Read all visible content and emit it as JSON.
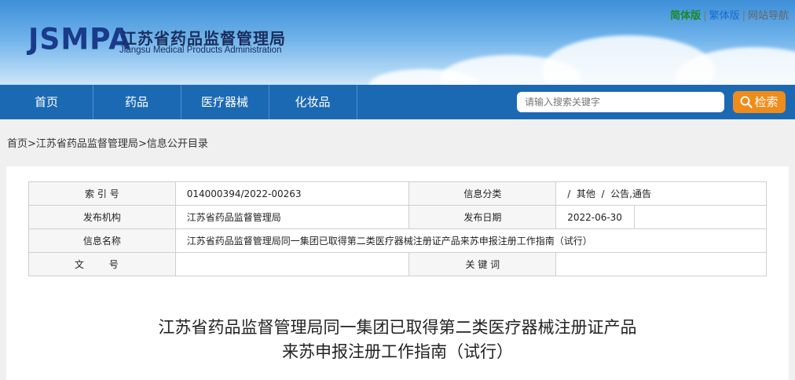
{
  "header": {
    "logo_mark": "JSMPA",
    "logo_cn": "江苏省药品监督管理局",
    "logo_en": "Jiangsu Medical Products Administration",
    "links": {
      "simplified": "简体版",
      "traditional": "繁体版",
      "sitemap": "网站导航",
      "sep": "|"
    }
  },
  "nav": {
    "items": [
      "首页",
      "药品",
      "医疗器械",
      "化妆品"
    ],
    "search_placeholder": "请输入搜索关键字",
    "search_button": "检索"
  },
  "breadcrumb": {
    "home": "首页",
    "level1": "江苏省药品监督管理局",
    "level2": "信息公开目录",
    "sep": ">"
  },
  "info_table": {
    "index_label": "索 引 号",
    "index_value": "014000394/2022-00263",
    "category_label": "信息分类",
    "category_value": "/  其他  /  公告,通告",
    "publisher_label": "发布机构",
    "publisher_value": "江苏省药品监督管理局",
    "date_label": "发布日期",
    "date_value": "2022-06-30",
    "name_label": "信息名称",
    "name_value": "江苏省药品监督管理局同一集团已取得第二类医疗器械注册证产品来苏申报注册工作指南（试行）",
    "docno_label": "文 号",
    "docno_value": "",
    "keywords_label": "关 键 词",
    "keywords_value": ""
  },
  "article": {
    "title_line1": "江苏省药品监督管理局同一集团已取得第二类医疗器械注册证产品",
    "title_line2": "来苏申报注册工作指南（试行）"
  },
  "colors": {
    "nav": "#1c69b3",
    "search_button": "#f08c1a",
    "logo": "#1a3a8a"
  }
}
